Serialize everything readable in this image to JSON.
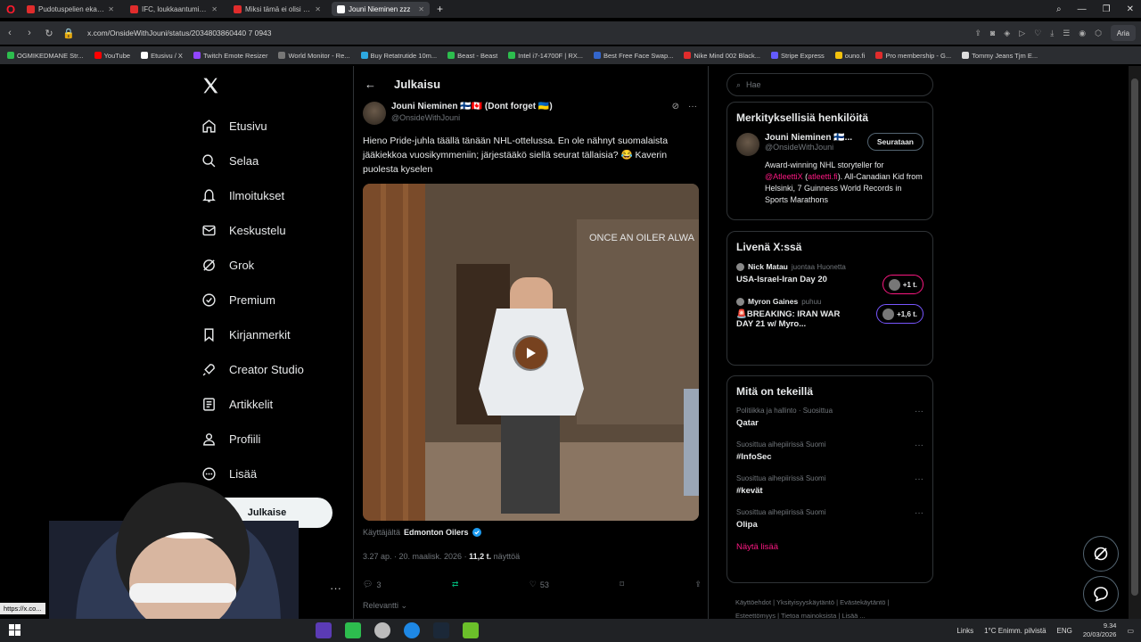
{
  "browser": {
    "tabs": [
      {
        "title": "Pudotuspelien ekan kierro",
        "color": "#e02c2c",
        "active": false
      },
      {
        "title": "IFC, loukkaantuminen & V",
        "color": "#e02c2c",
        "active": false
      },
      {
        "title": "Miksi tämä ei olisi Patrik L",
        "color": "#e02c2c",
        "active": false
      },
      {
        "title": "Jouni Nieminen zzz",
        "color": "#ffffff",
        "active": true
      }
    ],
    "url": "x.com/OnsideWithJouni/status/2034803860440 7 0943",
    "ai_label": "Aria",
    "bookmarks": [
      {
        "label": "OGMIKEDMANE Str...",
        "color": "#2dbd4e"
      },
      {
        "label": "YouTube",
        "color": "#ff0000"
      },
      {
        "label": "Etusivu / X",
        "color": "#ffffff"
      },
      {
        "label": "Twitch Emote Resizer",
        "color": "#9146ff"
      },
      {
        "label": "World Monitor - Re...",
        "color": "#777777"
      },
      {
        "label": "Buy Retatrutide 10m...",
        "color": "#2da8e0"
      },
      {
        "label": "Beast - Beast",
        "color": "#2dbd4e"
      },
      {
        "label": "Intel i7-14700F | RX...",
        "color": "#2dbd4e"
      },
      {
        "label": "Best Free Face Swap...",
        "color": "#3366cc"
      },
      {
        "label": "Nike Mind 002 Black...",
        "color": "#e02c2c"
      },
      {
        "label": "Stripe Express",
        "color": "#635bff"
      },
      {
        "label": "ounо.fi",
        "color": "#f4c20d"
      },
      {
        "label": "Pro membership - G...",
        "color": "#e02c2c"
      },
      {
        "label": "Tommy Jeans Tjm E...",
        "color": "#dddddd"
      }
    ]
  },
  "sidebar": {
    "items": [
      {
        "label": "Etusivu",
        "icon": "home-icon"
      },
      {
        "label": "Selaa",
        "icon": "search-icon"
      },
      {
        "label": "Ilmoitukset",
        "icon": "bell-icon"
      },
      {
        "label": "Keskustelu",
        "icon": "mail-icon"
      },
      {
        "label": "Grok",
        "icon": "grok-icon"
      },
      {
        "label": "Premium",
        "icon": "premium-icon"
      },
      {
        "label": "Kirjanmerkit",
        "icon": "bookmark-icon"
      },
      {
        "label": "Creator Studio",
        "icon": "rocket-icon"
      },
      {
        "label": "Artikkelit",
        "icon": "article-icon"
      },
      {
        "label": "Profiili",
        "icon": "profile-icon"
      },
      {
        "label": "Lisää",
        "icon": "more-icon"
      }
    ],
    "post_button": "Julkaise"
  },
  "main": {
    "header_title": "Julkaisu",
    "author_name": "Jouni Nieminen 🇫🇮🇨🇦 (Dont forget 🇺🇦)",
    "author_handle": "@OnsideWithJouni",
    "tweet_text": "Hieno Pride-juhla täällä tänään NHL-ottelussa. En ole nähnyt suomalaista jääkiekkoa vuosikymmeniin; järjestääkö siellä seurat tällaisia? 😂 Kaverin puolesta kyselen",
    "media_caption": "ONCE AN OILER ALWA",
    "attribution_prefix": "Käyttäjältä",
    "attribution_name": "Edmonton Oilers",
    "meta_time": "3.27 ap. · 20. maalisk. 2026 ·",
    "views_count": "11,2 t.",
    "views_label": "näyttöä",
    "replies": "3",
    "likes": "53",
    "sort_label": "Relevantti"
  },
  "right": {
    "search_placeholder": "Hae",
    "relevant_title": "Merkityksellisiä henkilöitä",
    "rel_name": "Jouni Nieminen 🇫🇮...",
    "rel_handle": "@OnsideWithJouni",
    "follow_label": "Seurataan",
    "bio_pre": "Award-winning NHL storyteller for",
    "bio_link1": "@AtleettiX",
    "bio_paren_open": " (",
    "bio_link2": "atleetti.fi",
    "bio_post": "). All-Canadian Kid from Helsinki, 7 Guinness World Records in Sports Marathons",
    "live_title": "Livenä X:ssä",
    "live": [
      {
        "host": "Nick Matau",
        "status": "juontaa Huonetta",
        "title": "USA-Israel-Iran Day 20",
        "count": "+1 t.",
        "pill_color": "#f91880"
      },
      {
        "host": "Myron Gaines",
        "status": "puhuu",
        "title": "🚨BREAKING: IRAN WAR DAY 21 w/ Myro...",
        "count": "+1,6 t.",
        "pill_color": "#7856ff"
      }
    ],
    "trends_title": "Mitä on tekeillä",
    "trends": [
      {
        "category": "Politiikka ja hallinto · Suosittua",
        "title": "Qatar"
      },
      {
        "category": "Suosittua aihepiirissä Suomi",
        "title": "#InfoSec"
      },
      {
        "category": "Suosittua aihepiirissä Suomi",
        "title": "#kevät"
      },
      {
        "category": "Suosittua aihepiirissä Suomi",
        "title": "Olipa"
      }
    ],
    "show_more": "Näytä lisää",
    "footer_line1": "Käyttöehdot  |  Yksityisyyskäytäntö  |  Evästekäytäntö  |",
    "footer_line2": "Esteettömyys  |  Tietoa mainoksista  |  Lisää ..."
  },
  "taskbar": {
    "links": "Links",
    "weather": "1°C  Enimm. pilvistä",
    "lang": "ENG",
    "time": "9.34",
    "date": "20/03/2026"
  },
  "status_url": "https://x.co..."
}
